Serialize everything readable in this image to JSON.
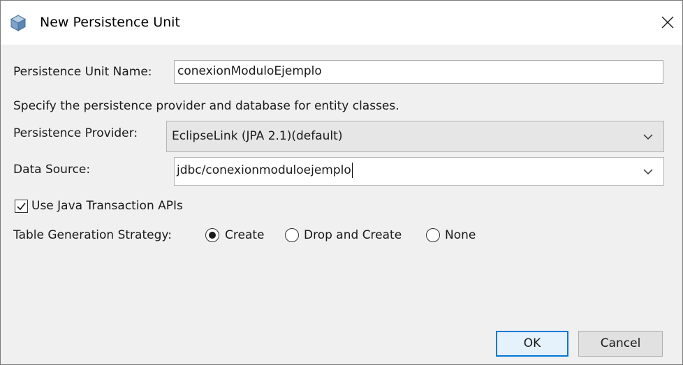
{
  "window": {
    "title": "New Persistence Unit",
    "title_icon": "cube-icon",
    "close_icon": "close-icon"
  },
  "form": {
    "unit_name_label": "Persistence Unit Name:",
    "unit_name_value": "conexionModuloEjemplo",
    "description": "Specify the persistence provider and database for entity classes.",
    "provider_label": "Persistence Provider:",
    "provider_value": "EclipseLink (JPA 2.1)(default)",
    "datasource_label": "Data Source:",
    "datasource_value": "jdbc/conexionmoduloejemplo",
    "jta_label": "Use Java Transaction APIs",
    "jta_checked": true,
    "strategy_label": "Table Generation Strategy:",
    "strategy_options": [
      {
        "label": "Create",
        "selected": true
      },
      {
        "label": "Drop and Create",
        "selected": false
      },
      {
        "label": "None",
        "selected": false
      }
    ]
  },
  "buttons": {
    "ok_label": "OK",
    "cancel_label": "Cancel"
  },
  "colors": {
    "accent": "#0078d7",
    "dialog_bg": "#f0f0f0"
  }
}
